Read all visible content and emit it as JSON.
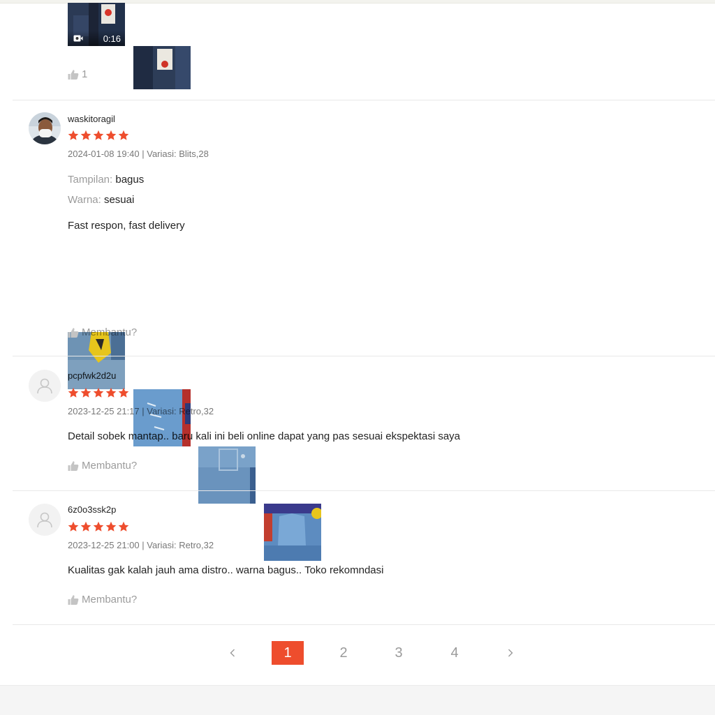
{
  "colors": {
    "accent": "#ee4d2d",
    "star": "#ee4d2d",
    "divider": "#e8e8e8"
  },
  "previous_review": {
    "video_duration": "0:16",
    "helpful_count": "1"
  },
  "reviews": [
    {
      "username": "waskitoragil",
      "rating": 5,
      "meta": "2024-01-08 19:40 | Variasi: Blits,28",
      "attributes": [
        {
          "key": "Tampilan:",
          "value": "bagus"
        },
        {
          "key": "Warna:",
          "value": "sesuai"
        }
      ],
      "comment": "Fast respon, fast delivery",
      "helpful_label": "Membantu?"
    },
    {
      "username": "pcpfwk2d2u",
      "rating": 5,
      "meta": "2023-12-25 21:17 | Variasi: Retro,32",
      "comment": "Detail sobek mantap.. baru kali ini beli online dapat yang pas sesuai ekspektasi saya",
      "helpful_label": "Membantu?"
    },
    {
      "username": "6z0o3ssk2p",
      "rating": 5,
      "meta": "2023-12-25 21:00 | Variasi: Retro,32",
      "comment": "Kualitas gak kalah jauh ama distro.. warna bagus.. Toko rekomndasi",
      "helpful_label": "Membantu?"
    }
  ],
  "pagination": {
    "prev_icon": "chevron-left-icon",
    "next_icon": "chevron-right-icon",
    "pages": [
      "1",
      "2",
      "3",
      "4"
    ],
    "current": "1"
  }
}
